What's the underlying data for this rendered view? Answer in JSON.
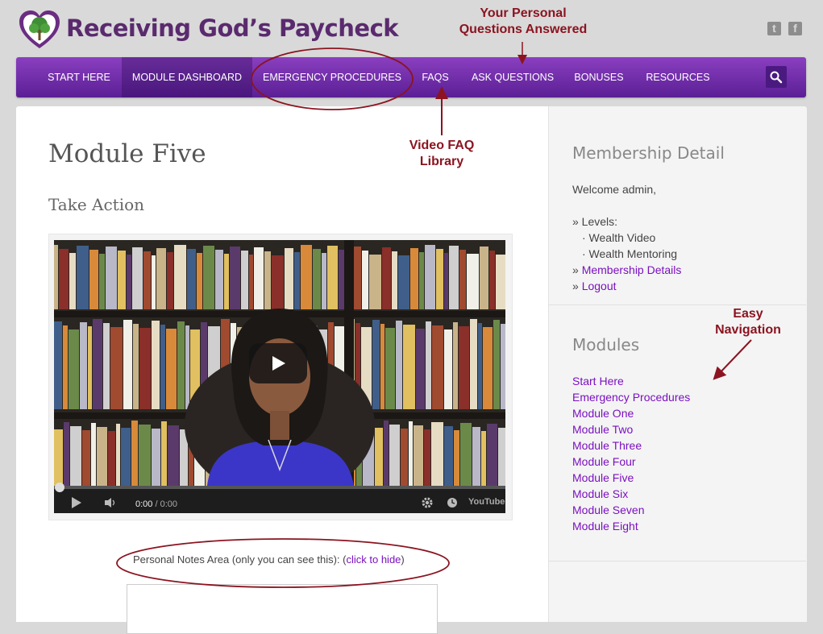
{
  "header": {
    "site_title": "Receiving God’s Paycheck",
    "social": [
      {
        "name": "twitter-icon",
        "glyph": "t"
      },
      {
        "name": "facebook-icon",
        "glyph": "f"
      }
    ]
  },
  "nav": {
    "items": [
      {
        "label": "START HERE",
        "active": false
      },
      {
        "label": "MODULE DASHBOARD",
        "active": true
      },
      {
        "label": "EMERGENCY PROCEDURES",
        "active": false
      },
      {
        "label": "FAQS",
        "active": false
      },
      {
        "label": "ASK QUESTIONS",
        "active": false
      },
      {
        "label": "BONUSES",
        "active": false
      },
      {
        "label": "RESOURCES",
        "active": false
      }
    ],
    "search_icon": "search-icon"
  },
  "main": {
    "title": "Module Five",
    "subtitle": "Take Action",
    "video": {
      "current_time": "0:00",
      "separator": " / ",
      "duration": "0:00",
      "brand": "YouTube"
    },
    "notes": {
      "label": "Personal Notes Area (only you can see this): ",
      "paren_open": "(",
      "toggle_link": "click to hide",
      "paren_close": ")"
    }
  },
  "sidebar": {
    "membership": {
      "title": "Membership Detail",
      "welcome": "Welcome admin,",
      "levels_label": "» Levels:",
      "levels": [
        "· Wealth Video",
        "· Wealth Mentoring"
      ],
      "links": [
        {
          "prefix": "» ",
          "label": "Membership Details"
        },
        {
          "prefix": "» ",
          "label": "Logout"
        }
      ]
    },
    "modules": {
      "title": "Modules",
      "items": [
        "Start Here",
        "Emergency Procedures",
        "Module One",
        "Module Two",
        "Module Three",
        "Module Four",
        "Module Five",
        "Module Six",
        "Module Seven",
        "Module Eight"
      ]
    }
  },
  "annotations": {
    "personal_questions": [
      "Your Personal",
      "Questions Answered"
    ],
    "video_faq": [
      "Video FAQ",
      "Library"
    ],
    "easy_nav": [
      "Easy",
      "Navigation"
    ]
  },
  "colors": {
    "nav_gradient_top": "#8a3fc0",
    "nav_gradient_bottom": "#5b1f95",
    "link": "#7a10c0",
    "annotation": "#8b1420",
    "title_purple": "#5a2a6e"
  }
}
